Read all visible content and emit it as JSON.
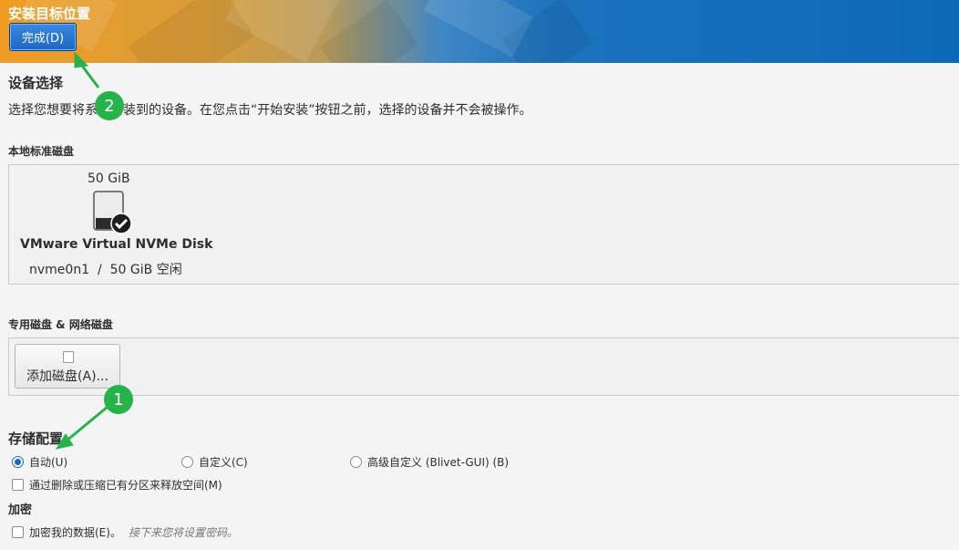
{
  "header": {
    "title": "安装目标位置",
    "done_button": "完成(D)"
  },
  "device_selection": {
    "title": "设备选择",
    "description": "选择您想要将系统安装到的设备。在您点击“开始安装”按钮之前，选择的设备并不会被操作。"
  },
  "local_disks": {
    "label": "本地标准磁盘",
    "disk": {
      "size": "50 GiB",
      "name": "VMware Virtual NVMe Disk",
      "device": "nvme0n1",
      "separator": "/",
      "free": "50 GiB 空闲",
      "selected": true
    }
  },
  "special_disks": {
    "label": "专用磁盘 & 网络磁盘",
    "add_button": "添加磁盘(A)..."
  },
  "storage": {
    "title": "存储配置",
    "options": [
      {
        "label": "自动(U)",
        "selected": true
      },
      {
        "label": "自定义(C)",
        "selected": false
      },
      {
        "label": "高级自定义 (Blivet-GUI) (B)",
        "selected": false
      }
    ],
    "reclaim_label": "通过删除或压缩已有分区来释放空间(M)"
  },
  "encryption": {
    "title": "加密",
    "checkbox_label": "加密我的数据(E)。",
    "hint": "接下来您将设置密码。"
  },
  "annotations": {
    "marker_1": "1",
    "marker_2": "2",
    "color": "#26b34a"
  }
}
